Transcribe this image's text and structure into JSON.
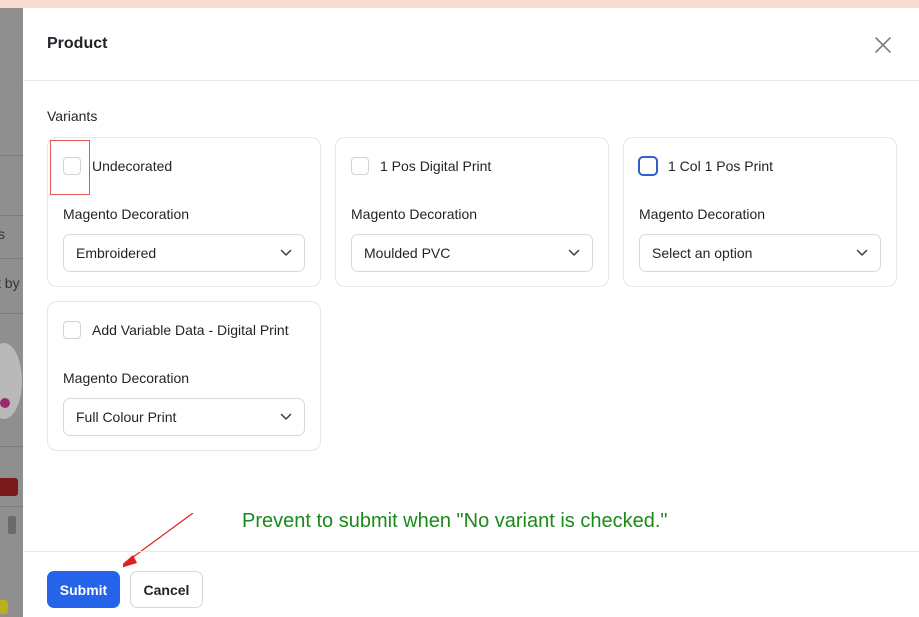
{
  "modal": {
    "title": "Product",
    "section_label": "Variants"
  },
  "variants": [
    {
      "label": "Undecorated",
      "checked": false,
      "field_label": "Magento Decoration",
      "selected": "Embroidered"
    },
    {
      "label": "1 Pos Digital Print",
      "checked": false,
      "field_label": "Magento Decoration",
      "selected": "Moulded PVC"
    },
    {
      "label": "1 Col 1 Pos Print",
      "checked": false,
      "field_label": "Magento Decoration",
      "selected": "Select an option"
    },
    {
      "label": "Add Variable Data - Digital Print",
      "checked": false,
      "field_label": "Magento Decoration",
      "selected": "Full Colour Print"
    }
  ],
  "annotation": "Prevent to submit when \"No variant is checked.\"",
  "footer": {
    "submit_label": "Submit",
    "cancel_label": "Cancel"
  },
  "background_fragments": {
    "text_1": "s",
    "text_2": "t by"
  },
  "colors": {
    "primary": "#2563eb",
    "annotation": "#1a8a1a",
    "highlight": "#e05a5a"
  }
}
